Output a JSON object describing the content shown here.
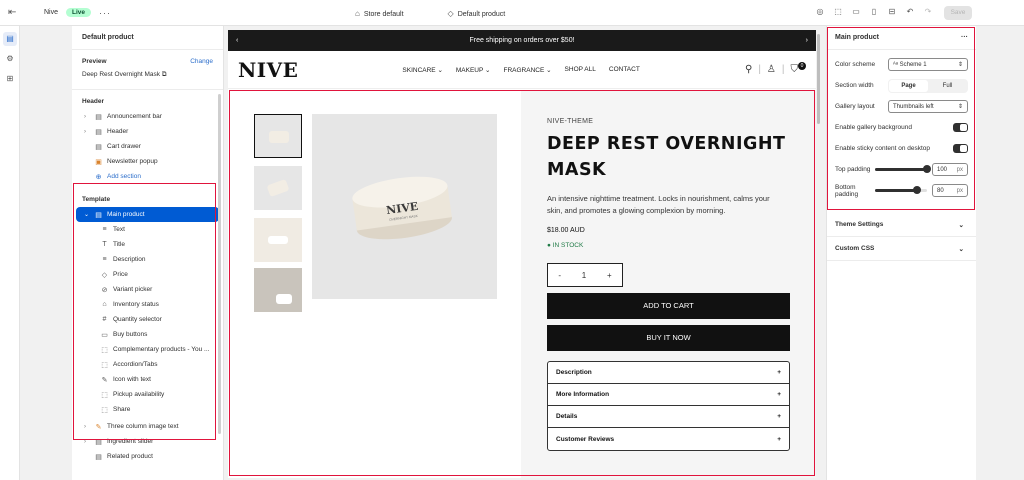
{
  "topbar": {
    "theme_name": "Nive",
    "live_badge": "Live",
    "more": "···",
    "store_label": "Store default",
    "template_label": "Default product",
    "save_label": "Save"
  },
  "left_panel": {
    "title": "Default product",
    "preview_label": "Preview",
    "change_label": "Change",
    "preview_value": "Deep Rest Overnight Mask",
    "header_section": "Header",
    "header_items": [
      "Announcement bar",
      "Header",
      "Cart drawer",
      "Newsletter popup"
    ],
    "add_section": "Add section",
    "template_section": "Template",
    "main_product": "Main product",
    "blocks": [
      "Text",
      "Title",
      "Description",
      "Price",
      "Variant picker",
      "Inventory status",
      "Quantity selector",
      "Buy buttons",
      "Complementary products - You ...",
      "Accordion/Tabs",
      "Icon with text",
      "Pickup availability",
      "Share"
    ],
    "after_items": [
      "Three column image text",
      "Ingredient slider",
      "Related product"
    ]
  },
  "store": {
    "announcement": "Free shipping on orders over $50!",
    "logo": "NIVE",
    "nav": [
      "SKINCARE ⌄",
      "MAKEUP ⌄",
      "FRAGRANCE ⌄",
      "SHOP ALL",
      "CONTACT"
    ],
    "cart_count": "0",
    "product_logo": "NIVE",
    "product_sub": "OVERNIGHT MASK"
  },
  "product": {
    "vendor": "NIVE-THEME",
    "title": "DEEP REST OVERNIGHT MASK",
    "description": "An intensive nighttime treatment. Locks in nourishment, calms your skin, and promotes a glowing complexion by morning.",
    "price": "$18.00 AUD",
    "stock": "● IN STOCK",
    "qty_minus": "-",
    "qty_value": "1",
    "qty_plus": "+",
    "add_to_cart": "ADD TO CART",
    "buy_now": "BUY IT NOW",
    "accordion": [
      "Description",
      "More Information",
      "Details",
      "Customer Reviews"
    ]
  },
  "right_panel": {
    "title": "Main product",
    "more": "···",
    "color_scheme_label": "Color scheme",
    "color_scheme_value": "Scheme 1",
    "section_width_label": "Section width",
    "width_options": [
      "Page",
      "Full"
    ],
    "gallery_layout_label": "Gallery layout",
    "gallery_layout_value": "Thumbnails left",
    "gallery_bg_label": "Enable gallery background",
    "sticky_label": "Enable sticky content on desktop",
    "top_padding_label": "Top padding",
    "top_padding_value": "100",
    "bottom_padding_label": "Bottom padding",
    "bottom_padding_value": "80",
    "unit": "px",
    "theme_settings": "Theme Settings",
    "custom_css": "Custom CSS"
  },
  "sliders": {
    "top_fraction": 1.0,
    "bottom_fraction": 0.8
  },
  "colors": {
    "accent": "#005bd3",
    "highlight": "#e0143c",
    "live": "#b4fed2"
  }
}
